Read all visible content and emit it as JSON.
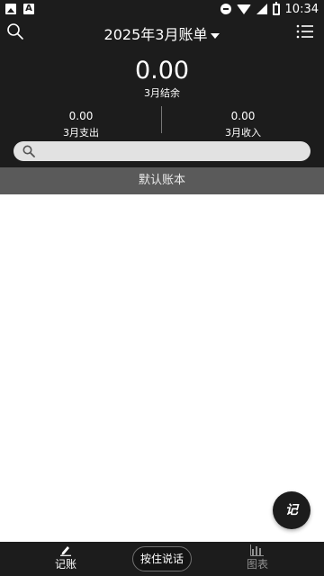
{
  "status_bar": {
    "time": "10:34"
  },
  "header": {
    "title": "2025年3月账单",
    "balance": {
      "amount": "0.00",
      "label": "3月结余"
    },
    "expense": {
      "amount": "0.00",
      "label": "3月支出"
    },
    "income": {
      "amount": "0.00",
      "label": "3月收入"
    },
    "search": {
      "placeholder": ""
    }
  },
  "ledger": {
    "name": "默认账本"
  },
  "fab": {
    "label": "记"
  },
  "bottom_nav": {
    "record_label": "记账",
    "voice_label": "按住说话",
    "chart_label": "图表"
  },
  "icons": {
    "search": "search-icon",
    "menu": "list-menu-icon",
    "record": "pen-icon",
    "chart": "bar-chart-icon"
  },
  "colors": {
    "header_bg": "#1c1c1c",
    "ledger_bar_bg": "#5a5a5a",
    "search_bar_bg": "#e2e2e2",
    "inactive_tab": "#8f8f8f"
  }
}
